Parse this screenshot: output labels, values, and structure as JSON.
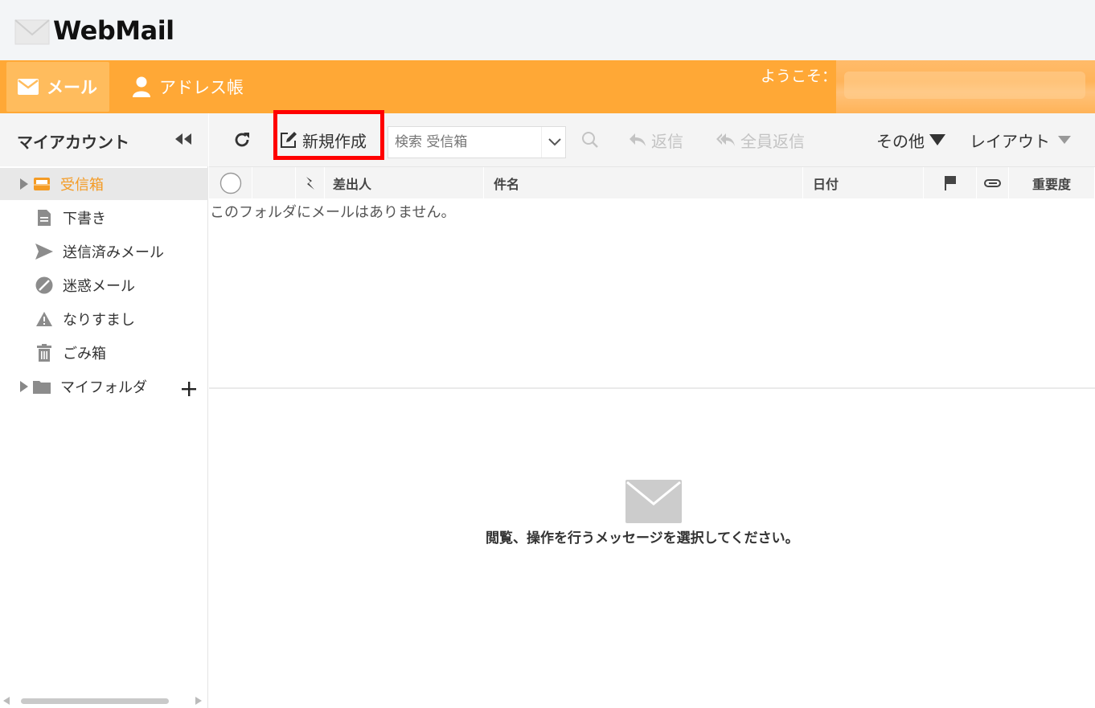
{
  "app": {
    "logo_text": "WebMail"
  },
  "nav": {
    "mail_label": "メール",
    "address_label": "アドレス帳",
    "welcome": "ようこそ："
  },
  "sidebar": {
    "title": "マイアカウント",
    "folders": [
      {
        "label": "受信箱",
        "icon": "inbox-icon"
      },
      {
        "label": "下書き",
        "icon": "draft-icon"
      },
      {
        "label": "送信済みメール",
        "icon": "sent-icon"
      },
      {
        "label": "迷惑メール",
        "icon": "spam-icon"
      },
      {
        "label": "なりすまし",
        "icon": "warning-icon"
      },
      {
        "label": "ごみ箱",
        "icon": "trash-icon"
      },
      {
        "label": "マイフォルダ",
        "icon": "folder-icon"
      }
    ]
  },
  "toolbar": {
    "compose_label": "新規作成",
    "search_placeholder": "検索 受信箱",
    "reply_label": "返信",
    "reply_all_label": "全員返信",
    "more_label": "その他",
    "layout_label": "レイアウト"
  },
  "list": {
    "columns": {
      "from": "差出人",
      "subject": "件名",
      "date": "日付",
      "priority": "重要度"
    },
    "empty_message": "このフォルダにメールはありません。"
  },
  "preview": {
    "message": "閲覧、操作を行うメッセージを選択してください。"
  },
  "colors": {
    "accent": "#ffa836",
    "active_folder": "#f49b24",
    "highlight": "#ff0000"
  }
}
